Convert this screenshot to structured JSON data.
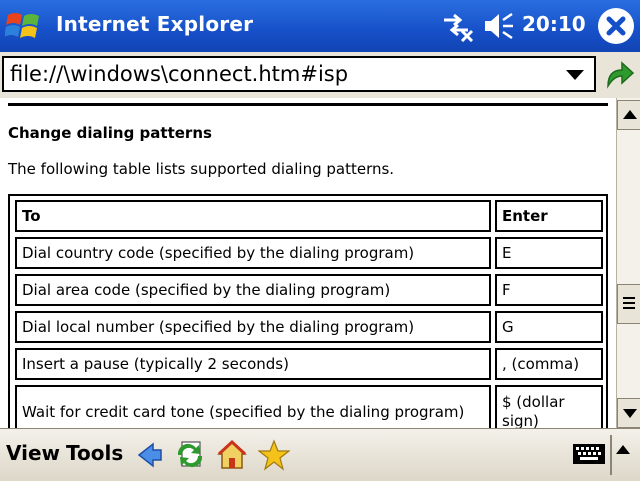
{
  "titlebar": {
    "title": "Internet Explorer",
    "clock": "20:10",
    "icons": [
      "windows-logo-icon",
      "connectivity-icon",
      "volume-icon",
      "close-icon"
    ]
  },
  "address": {
    "url": "file://\\windows\\connect.htm#isp"
  },
  "content": {
    "heading": "Change dialing patterns",
    "intro": "The following table lists supported dialing patterns.",
    "table": {
      "headers": [
        "To",
        "Enter"
      ],
      "rows": [
        [
          "Dial country code (specified by the dialing program)",
          "E"
        ],
        [
          "Dial area code (specified by the dialing program)",
          "F"
        ],
        [
          "Dial local number (specified by the dialing program)",
          "G"
        ],
        [
          "Insert a pause (typically 2 seconds)",
          ", (comma)"
        ],
        [
          "Wait for credit card tone (specified by the dialing program)",
          "$ (dollar sign)"
        ]
      ]
    }
  },
  "menubar": {
    "view_label": "View",
    "tools_label": "Tools",
    "icons": [
      "back-icon",
      "refresh-icon",
      "home-icon",
      "favorites-icon",
      "keyboard-icon"
    ]
  },
  "colors": {
    "titlebar": "#1650c8",
    "chrome": "#e9e4d8",
    "go_green": "#2e9a2e"
  }
}
